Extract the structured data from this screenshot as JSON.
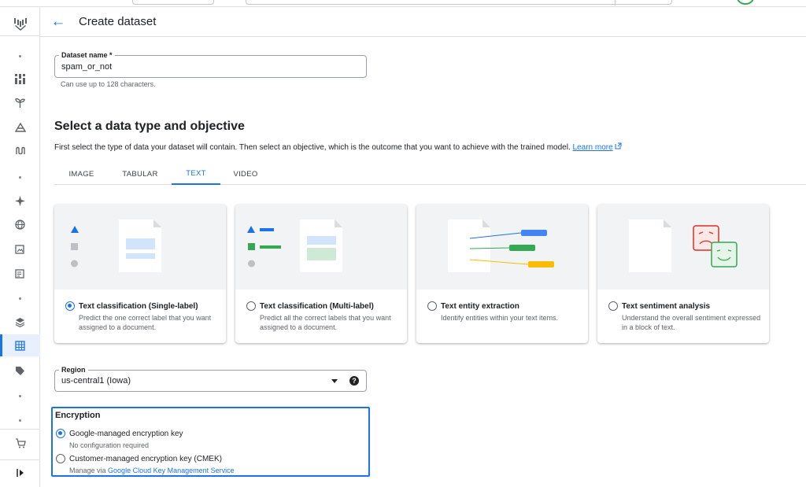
{
  "header": {
    "back_icon": "arrow-back-icon",
    "title": "Create dataset"
  },
  "dataset_name": {
    "label": "Dataset name *",
    "value": "spam_or_not",
    "hint": "Can use up to 128 characters."
  },
  "section": {
    "title": "Select a data type and objective",
    "description": "First select the type of data your dataset will contain. Then select an objective, which is the outcome that you want to achieve with the trained model.",
    "learn_more": "Learn more",
    "learn_more_icon": "open-in-new-icon"
  },
  "tabs": [
    {
      "label": "IMAGE",
      "active": false
    },
    {
      "label": "TABULAR",
      "active": false
    },
    {
      "label": "TEXT",
      "active": true
    },
    {
      "label": "VIDEO",
      "active": false
    }
  ],
  "cards": [
    {
      "title": "Text classification (Single-label)",
      "description": "Predict the one correct label that you want assigned to a document.",
      "selected": true
    },
    {
      "title": "Text classification (Multi-label)",
      "description": "Predict all the correct labels that you want assigned to a document.",
      "selected": false
    },
    {
      "title": "Text entity extraction",
      "description": "Identify entities within your text items.",
      "selected": false
    },
    {
      "title": "Text sentiment analysis",
      "description": "Understand the overall sentiment expressed in a block of text.",
      "selected": false
    }
  ],
  "region": {
    "label": "Region",
    "value": "us-central1 (Iowa)",
    "help_icon": "help-icon",
    "help_glyph": "?"
  },
  "encryption": {
    "title": "Encryption",
    "options": [
      {
        "label": "Google-managed encryption key",
        "sublabel": "No configuration required",
        "selected": true
      },
      {
        "label": "Customer-managed encryption key (CMEK)",
        "sublabel_prefix": "Manage via",
        "sublabel_link": "Google Cloud Key Management Service",
        "selected": false
      }
    ]
  },
  "colors": {
    "accent": "#1a73e8",
    "illustration_bg": "#f1f3f4",
    "red_face": "#d93025",
    "green_face": "#34a853",
    "yellow_chip": "#fbbc04"
  }
}
